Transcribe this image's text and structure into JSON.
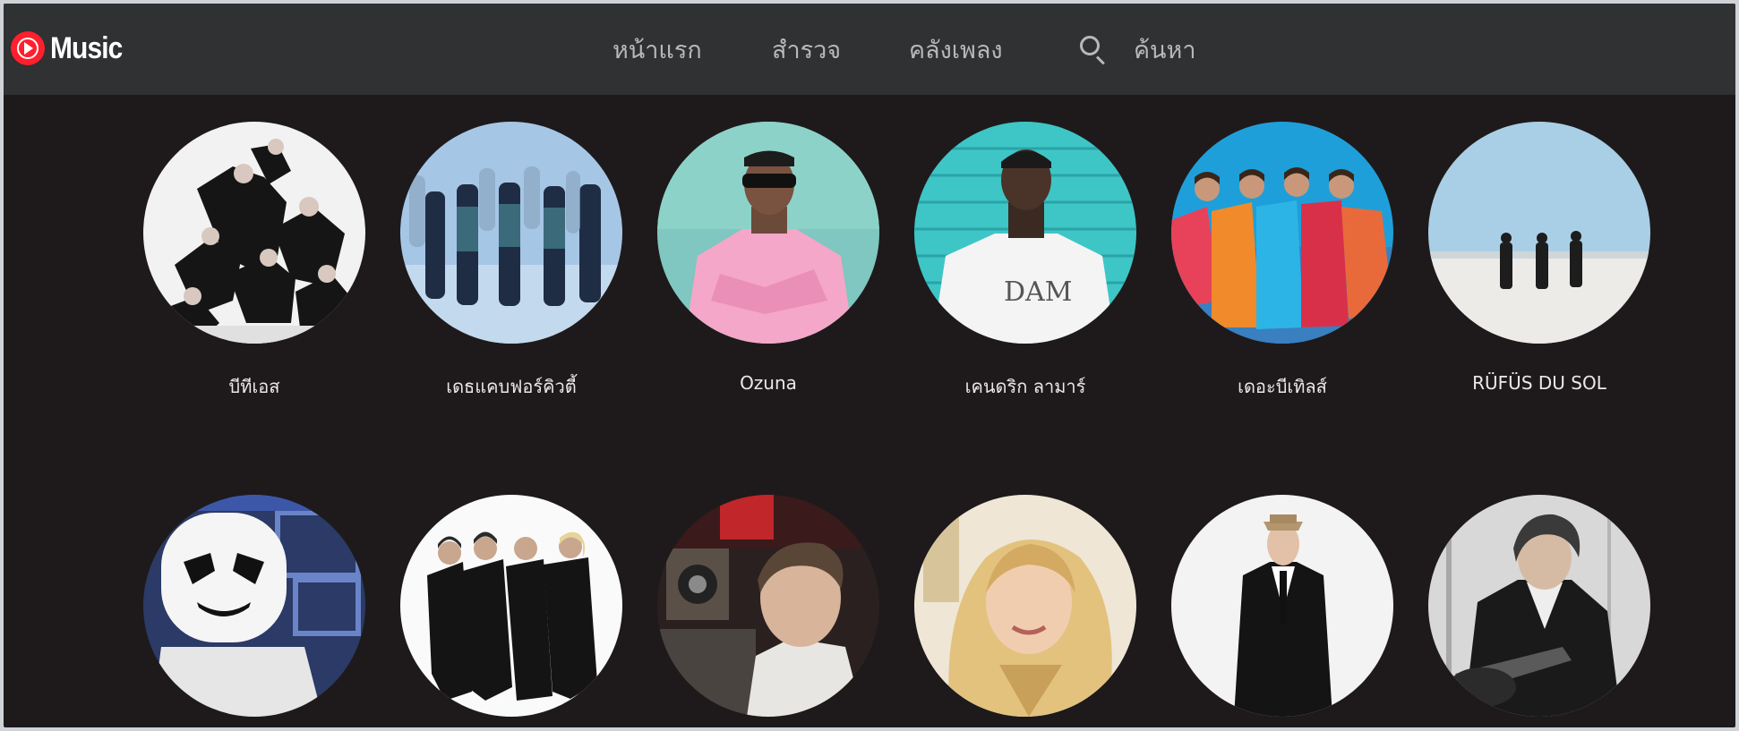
{
  "app": {
    "logo_text": "Music"
  },
  "nav": {
    "home": "หน้าแรก",
    "explore": "สำรวจ",
    "library": "คลังเพลง",
    "search": "ค้นหา"
  },
  "artists": [
    {
      "name": "บีทีเอส"
    },
    {
      "name": "เดธแคบฟอร์คิวตี้"
    },
    {
      "name": "Ozuna"
    },
    {
      "name": "เคนดริก ลามาร์"
    },
    {
      "name": "เดอะบีเทิลส์"
    },
    {
      "name": "RÜFÜS DU SOL"
    },
    {
      "name": ""
    },
    {
      "name": ""
    },
    {
      "name": ""
    },
    {
      "name": ""
    },
    {
      "name": ""
    },
    {
      "name": ""
    }
  ],
  "colors": {
    "background": "#1e1a1b",
    "topbar": "#2f3133",
    "brand_red": "#ff1f2d",
    "nav_text": "#b7b8b9",
    "label_text": "#e9e9e9"
  }
}
